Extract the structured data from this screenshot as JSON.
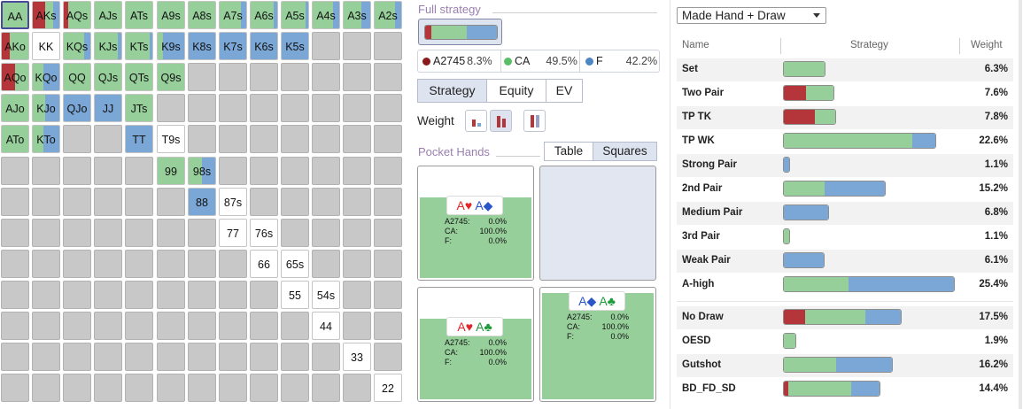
{
  "colors": {
    "raise": "#b5363a",
    "call": "#96cf9a",
    "fold": "#7ba7d6",
    "inactive": "#c8c8c8"
  },
  "grid": {
    "cells": [
      {
        "r": 0,
        "c": 0,
        "l": "AA",
        "s": [
          0,
          1,
          0
        ],
        "sel": true
      },
      {
        "r": 0,
        "c": 1,
        "l": "AKs",
        "s": [
          0.45,
          0.3,
          0.25
        ]
      },
      {
        "r": 0,
        "c": 2,
        "l": "AQs",
        "s": [
          0.15,
          0.85,
          0
        ]
      },
      {
        "r": 0,
        "c": 3,
        "l": "AJs",
        "s": [
          0,
          1,
          0
        ]
      },
      {
        "r": 0,
        "c": 4,
        "l": "ATs",
        "s": [
          0,
          1,
          0
        ]
      },
      {
        "r": 0,
        "c": 5,
        "l": "A9s",
        "s": [
          0,
          1,
          0
        ]
      },
      {
        "r": 0,
        "c": 6,
        "l": "A8s",
        "s": [
          0,
          1,
          0
        ]
      },
      {
        "r": 0,
        "c": 7,
        "l": "A7s",
        "s": [
          0,
          0.8,
          0.2
        ]
      },
      {
        "r": 0,
        "c": 8,
        "l": "A6s",
        "s": [
          0,
          0.85,
          0.15
        ]
      },
      {
        "r": 0,
        "c": 9,
        "l": "A5s",
        "s": [
          0,
          0.9,
          0.1
        ]
      },
      {
        "r": 0,
        "c": 10,
        "l": "A4s",
        "s": [
          0,
          0.75,
          0.25
        ]
      },
      {
        "r": 0,
        "c": 11,
        "l": "A3s",
        "s": [
          0,
          0.65,
          0.35
        ]
      },
      {
        "r": 0,
        "c": 12,
        "l": "A2s",
        "s": [
          0,
          0.75,
          0.25
        ]
      },
      {
        "r": 1,
        "c": 0,
        "l": "AKo",
        "s": [
          0.3,
          0.7,
          0
        ]
      },
      {
        "r": 1,
        "c": 1,
        "l": "KK",
        "s": [
          0,
          0,
          0
        ],
        "white": true
      },
      {
        "r": 1,
        "c": 2,
        "l": "KQs",
        "s": [
          0,
          0.75,
          0.25
        ]
      },
      {
        "r": 1,
        "c": 3,
        "l": "KJs",
        "s": [
          0,
          0.85,
          0.15
        ]
      },
      {
        "r": 1,
        "c": 4,
        "l": "KTs",
        "s": [
          0,
          0.9,
          0.1
        ]
      },
      {
        "r": 1,
        "c": 5,
        "l": "K9s",
        "s": [
          0,
          0.2,
          0.8
        ]
      },
      {
        "r": 1,
        "c": 6,
        "l": "K8s",
        "s": [
          0,
          0,
          1
        ]
      },
      {
        "r": 1,
        "c": 7,
        "l": "K7s",
        "s": [
          0,
          0,
          1
        ]
      },
      {
        "r": 1,
        "c": 8,
        "l": "K6s",
        "s": [
          0,
          0,
          1
        ]
      },
      {
        "r": 1,
        "c": 9,
        "l": "K5s",
        "s": [
          0,
          0,
          1
        ]
      },
      {
        "r": 2,
        "c": 0,
        "l": "AQo",
        "s": [
          0.5,
          0.5,
          0
        ]
      },
      {
        "r": 2,
        "c": 1,
        "l": "KQo",
        "s": [
          0,
          0.4,
          0.6
        ]
      },
      {
        "r": 2,
        "c": 2,
        "l": "QQ",
        "s": [
          0,
          1,
          0
        ]
      },
      {
        "r": 2,
        "c": 3,
        "l": "QJs",
        "s": [
          0,
          1,
          0
        ]
      },
      {
        "r": 2,
        "c": 4,
        "l": "QTs",
        "s": [
          0,
          1,
          0
        ]
      },
      {
        "r": 2,
        "c": 5,
        "l": "Q9s",
        "s": [
          0,
          1,
          0
        ]
      },
      {
        "r": 3,
        "c": 0,
        "l": "AJo",
        "s": [
          0,
          1,
          0
        ]
      },
      {
        "r": 3,
        "c": 1,
        "l": "KJo",
        "s": [
          0,
          0.45,
          0.55
        ]
      },
      {
        "r": 3,
        "c": 2,
        "l": "QJo",
        "s": [
          0,
          0,
          1
        ]
      },
      {
        "r": 3,
        "c": 3,
        "l": "JJ",
        "s": [
          0,
          0,
          1
        ]
      },
      {
        "r": 3,
        "c": 4,
        "l": "JTs",
        "s": [
          0,
          1,
          0
        ]
      },
      {
        "r": 4,
        "c": 0,
        "l": "ATo",
        "s": [
          0,
          1,
          0
        ]
      },
      {
        "r": 4,
        "c": 1,
        "l": "KTo",
        "s": [
          0,
          0.4,
          0.6
        ]
      },
      {
        "r": 4,
        "c": 4,
        "l": "TT",
        "s": [
          0,
          0,
          1
        ]
      },
      {
        "r": 4,
        "c": 5,
        "l": "T9s",
        "s": [
          0,
          0,
          0
        ],
        "white": true
      },
      {
        "r": 5,
        "c": 5,
        "l": "99",
        "s": [
          0,
          1,
          0
        ]
      },
      {
        "r": 5,
        "c": 6,
        "l": "98s",
        "s": [
          0,
          0.5,
          0.5
        ]
      },
      {
        "r": 6,
        "c": 6,
        "l": "88",
        "s": [
          0,
          0,
          1
        ]
      },
      {
        "r": 6,
        "c": 7,
        "l": "87s",
        "s": [
          0,
          0,
          0
        ],
        "white": true
      },
      {
        "r": 7,
        "c": 7,
        "l": "77",
        "s": [
          0,
          0,
          0
        ],
        "white": true
      },
      {
        "r": 7,
        "c": 8,
        "l": "76s",
        "s": [
          0,
          0,
          0
        ],
        "white": true
      },
      {
        "r": 8,
        "c": 8,
        "l": "66",
        "s": [
          0,
          0,
          0
        ],
        "white": true
      },
      {
        "r": 8,
        "c": 9,
        "l": "65s",
        "s": [
          0,
          0,
          0
        ],
        "white": true
      },
      {
        "r": 9,
        "c": 9,
        "l": "55",
        "s": [
          0,
          0,
          0
        ],
        "white": true
      },
      {
        "r": 9,
        "c": 10,
        "l": "54s",
        "s": [
          0,
          0,
          0
        ],
        "white": true
      },
      {
        "r": 10,
        "c": 10,
        "l": "44",
        "s": [
          0,
          0,
          0
        ],
        "white": true
      },
      {
        "r": 11,
        "c": 11,
        "l": "33",
        "s": [
          0,
          0,
          0
        ],
        "white": true
      },
      {
        "r": 12,
        "c": 12,
        "l": "22",
        "s": [
          0,
          0,
          0
        ],
        "white": true
      }
    ]
  },
  "full_strategy": {
    "title": "Full strategy",
    "bar": [
      0.083,
      0.495,
      0.422
    ],
    "legend": [
      {
        "name": "A2745",
        "pct": "8.3%",
        "color": "#8b1a1a"
      },
      {
        "name": "CA",
        "pct": "49.5%",
        "color": "#5bbf67"
      },
      {
        "name": "F",
        "pct": "42.2%",
        "color": "#4e86c4"
      }
    ]
  },
  "tabs": {
    "strategy": "Strategy",
    "equity": "Equity",
    "ev": "EV"
  },
  "weight": {
    "label": "Weight"
  },
  "pocket_hands": {
    "title": "Pocket Hands",
    "table": "Table",
    "squares": "Squares",
    "cards": [
      {
        "r1": "A",
        "s1": "♥",
        "c1": "red",
        "r2": "A",
        "s2": "◆",
        "c2": "blue",
        "stats": [
          [
            "A2745:",
            "0.0%"
          ],
          [
            "CA:",
            "100.0%"
          ],
          [
            "F:",
            "0.0%"
          ]
        ],
        "fill": 0.72
      },
      {
        "r1": "A",
        "s1": "♥",
        "c1": "red",
        "r2": "A",
        "s2": "♣",
        "c2": "green",
        "stats": [
          [
            "A2745:",
            "0.0%"
          ],
          [
            "CA:",
            "100.0%"
          ],
          [
            "F:",
            "0.0%"
          ]
        ],
        "fill": 0.72
      },
      {
        "r1": "A",
        "s1": "◆",
        "c1": "blue",
        "r2": "A",
        "s2": "♣",
        "c2": "green",
        "stats": [
          [
            "A2745:",
            "0.0%"
          ],
          [
            "CA:",
            "100.0%"
          ],
          [
            "F:",
            "0.0%"
          ]
        ],
        "fill": 0.95
      }
    ]
  },
  "right": {
    "dropdown": "Made Hand + Draw",
    "headers": {
      "name": "Name",
      "strategy": "Strategy",
      "weight": "Weight"
    },
    "rows": [
      {
        "name": "Set",
        "weight": "6.3%",
        "w": 0.063,
        "s": [
          0,
          1,
          0
        ]
      },
      {
        "name": "Two Pair",
        "weight": "7.6%",
        "w": 0.076,
        "s": [
          0.45,
          0.55,
          0
        ]
      },
      {
        "name": "TP TK",
        "weight": "7.8%",
        "w": 0.078,
        "s": [
          0.6,
          0.4,
          0
        ]
      },
      {
        "name": "TP WK",
        "weight": "22.6%",
        "w": 0.226,
        "s": [
          0,
          0.85,
          0.15
        ]
      },
      {
        "name": "Strong Pair",
        "weight": "1.1%",
        "w": 0.011,
        "s": [
          0,
          0,
          1
        ]
      },
      {
        "name": "2nd Pair",
        "weight": "15.2%",
        "w": 0.152,
        "s": [
          0,
          0.4,
          0.6
        ]
      },
      {
        "name": "Medium Pair",
        "weight": "6.8%",
        "w": 0.068,
        "s": [
          0,
          0,
          1
        ]
      },
      {
        "name": "3rd Pair",
        "weight": "1.1%",
        "w": 0.011,
        "s": [
          0,
          1,
          0
        ]
      },
      {
        "name": "Weak Pair",
        "weight": "6.1%",
        "w": 0.061,
        "s": [
          0,
          0,
          1
        ]
      },
      {
        "name": "A-high",
        "weight": "25.4%",
        "w": 0.254,
        "s": [
          0,
          0.38,
          0.62
        ]
      },
      {
        "name": "No Draw",
        "weight": "17.5%",
        "w": 0.175,
        "s": [
          0.18,
          0.52,
          0.3
        ]
      },
      {
        "name": "OESD",
        "weight": "1.9%",
        "w": 0.019,
        "s": [
          0,
          1,
          0
        ]
      },
      {
        "name": "Gutshot",
        "weight": "16.2%",
        "w": 0.162,
        "s": [
          0,
          0.48,
          0.52
        ]
      },
      {
        "name": "BD_FD_SD",
        "weight": "14.4%",
        "w": 0.144,
        "s": [
          0.05,
          0.65,
          0.3
        ]
      }
    ]
  }
}
